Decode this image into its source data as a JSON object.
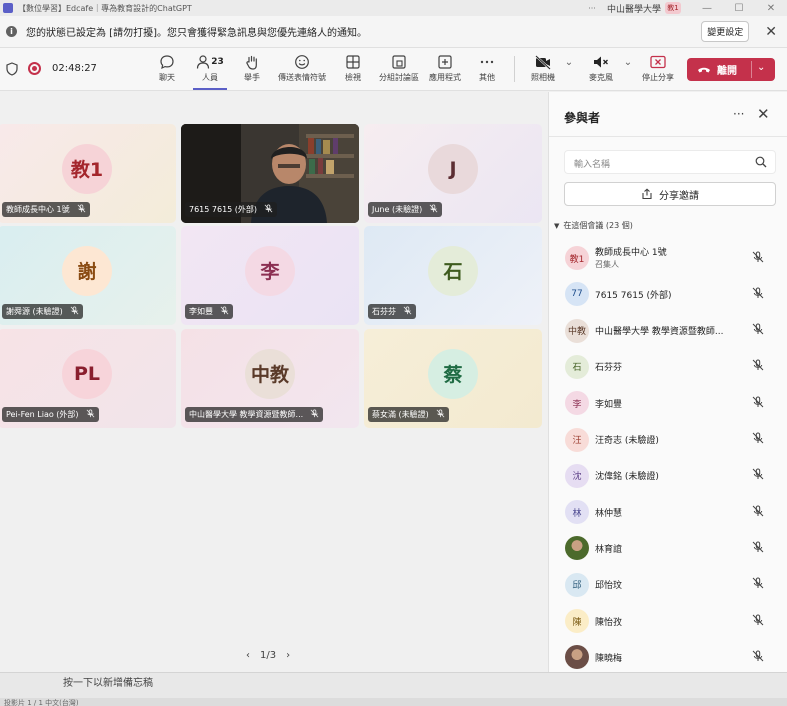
{
  "titlebar": {
    "title": "【數位學習】Edcafe｜專為教育設計的ChatGPT",
    "more": "···",
    "org": "中山醫學大學",
    "org_avatar": "教1",
    "min": "—",
    "max": "☐",
    "close": "✕"
  },
  "notification": {
    "message": "您的狀態已設定為 [請勿打擾]。您只會獲得緊急訊息與您優先連絡人的通知。",
    "change_button": "變更設定",
    "close": "✕"
  },
  "toolbar": {
    "timer": "02:48:27",
    "buttons": [
      {
        "label": "聊天"
      },
      {
        "label": "人員",
        "count": "23"
      },
      {
        "label": "舉手"
      },
      {
        "label": "傳送表情符號"
      },
      {
        "label": "檢視"
      },
      {
        "label": "分組討論區"
      },
      {
        "label": "應用程式"
      },
      {
        "label": "其他"
      },
      {
        "label": "照相機"
      },
      {
        "label": "麥克風"
      },
      {
        "label": "停止分享"
      }
    ],
    "leave_label": "離開"
  },
  "stage": {
    "tiles": [
      {
        "initials": "教1",
        "name": "教師成長中心 1號",
        "avatar_bg": "#f6d3d7",
        "avatar_fg": "#a4262c",
        "tile_bg": "linear-gradient(135deg,#f8e9ea,#f3ecd9)"
      },
      {
        "initials": "",
        "name": "7615 7615 (外部)",
        "video": true
      },
      {
        "initials": "J",
        "name": "June (未驗證)",
        "avatar_bg": "#e9d9db",
        "avatar_fg": "#5c2e33",
        "tile_bg": "linear-gradient(135deg,#f6edf0,#ebe6f3)"
      },
      {
        "initials": "謝",
        "name": "謝舜源 (未驗證)",
        "avatar_bg": "#fde7d3",
        "avatar_fg": "#8a4b12",
        "tile_bg": "linear-gradient(135deg,#d9eef0,#e7f1ec)"
      },
      {
        "initials": "李",
        "name": "李如豐",
        "avatar_bg": "#f4d9e4",
        "avatar_fg": "#8b2f52",
        "tile_bg": "linear-gradient(135deg,#f2e6f3,#eae3f4)"
      },
      {
        "initials": "石",
        "name": "石芬芬",
        "avatar_bg": "#e4ecd9",
        "avatar_fg": "#3e5b1e",
        "tile_bg": "linear-gradient(135deg,#dee9f4,#eef1f8)"
      },
      {
        "initials": "PL",
        "name": "Pei-Fen Liao (外部)",
        "avatar_bg": "#f7d4da",
        "avatar_fg": "#8a1f2e",
        "tile_bg": "linear-gradient(135deg,#f7e3e6,#f1e4ea)"
      },
      {
        "initials": "中教",
        "name": "中山醫學大學 教學資源暨教師...",
        "avatar_bg": "#eadfd8",
        "avatar_fg": "#5a3a29",
        "tile_bg": "linear-gradient(135deg,#f5e1e6,#f2e6ef)"
      },
      {
        "initials": "蔡",
        "name": "蔡女滿 (未驗證)",
        "avatar_bg": "#d6eee2",
        "avatar_fg": "#1f6b43",
        "tile_bg": "linear-gradient(135deg,#f6eed8,#f3ead0)"
      }
    ],
    "pager": {
      "prev": "‹",
      "label": "1/3",
      "next": "›"
    }
  },
  "notes": {
    "placeholder": "按一下以新增備忘稿",
    "bottom_text": "投影片 1 / 1    中文(台灣)"
  },
  "panel": {
    "title": "參與者",
    "more": "···",
    "close": "✕",
    "search_placeholder": "輸入名稱",
    "share_invite": "分享邀請",
    "section": "在這個會議 (23 個)",
    "participants": [
      {
        "initials": "教1",
        "name": "教師成長中心 1號",
        "role": "召集人",
        "bg": "#f6d3d7",
        "fg": "#a4262c"
      },
      {
        "initials": "77",
        "name": "7615 7615 (外部)",
        "bg": "#d6e4f5",
        "fg": "#1f4e8c"
      },
      {
        "initials": "中教",
        "name": "中山醫學大學 教學資源暨教師...",
        "bg": "#eadfd8",
        "fg": "#5a3a29"
      },
      {
        "initials": "石",
        "name": "石芬芬",
        "bg": "#e4ecd9",
        "fg": "#3e5b1e"
      },
      {
        "initials": "李",
        "name": "李如豐",
        "bg": "#f4d9e4",
        "fg": "#8b2f52"
      },
      {
        "initials": "汪",
        "name": "汪奇志 (未驗證)",
        "bg": "#f8dcd8",
        "fg": "#9a3b2e"
      },
      {
        "initials": "沈",
        "name": "沈偉銘 (未驗證)",
        "bg": "#e6ddf2",
        "fg": "#5a3d85"
      },
      {
        "initials": "林",
        "name": "林仲慧",
        "bg": "#e2e0f4",
        "fg": "#433f8a"
      },
      {
        "initials": "",
        "name": "林育誼",
        "photo": "#4c6a2c"
      },
      {
        "initials": "邱",
        "name": "邱怡玟",
        "bg": "#d9e8f2",
        "fg": "#2c5b7a"
      },
      {
        "initials": "陳",
        "name": "陳怡孜",
        "bg": "#fbedc7",
        "fg": "#7a5a12"
      },
      {
        "initials": "",
        "name": "陳曉梅",
        "photo": "#6b4e46"
      }
    ]
  }
}
